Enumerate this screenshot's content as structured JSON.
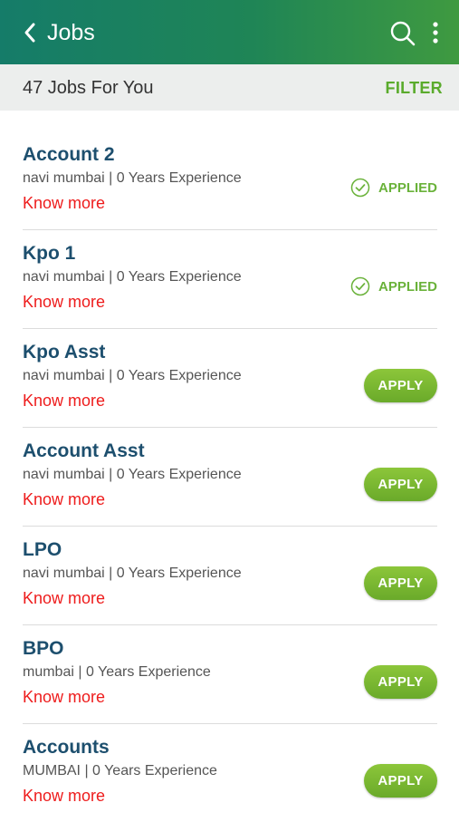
{
  "header": {
    "title": "Jobs",
    "icons": {
      "back": "chevron-left-icon",
      "search": "search-icon",
      "more": "more-vertical-icon"
    }
  },
  "subheader": {
    "count_text": "47 Jobs For You",
    "filter_label": "FILTER"
  },
  "jobs": [
    {
      "title": "Account 2",
      "meta": "navi mumbai | 0 Years Experience",
      "link": "Know more",
      "status": "APPLIED"
    },
    {
      "title": "Kpo 1",
      "meta": "navi mumbai | 0 Years Experience",
      "link": "Know more",
      "status": "APPLIED"
    },
    {
      "title": "Kpo Asst",
      "meta": "navi mumbai | 0 Years Experience",
      "link": "Know more",
      "status": "APPLY"
    },
    {
      "title": "Account Asst",
      "meta": "navi mumbai | 0 Years Experience",
      "link": "Know more",
      "status": "APPLY"
    },
    {
      "title": "LPO",
      "meta": "navi mumbai | 0 Years Experience",
      "link": "Know more",
      "status": "APPLY"
    },
    {
      "title": "BPO",
      "meta": "mumbai | 0 Years Experience",
      "link": "Know more",
      "status": "APPLY"
    },
    {
      "title": "Accounts",
      "meta": "MUMBAI | 0 Years Experience",
      "link": "Know more",
      "status": "APPLY"
    }
  ],
  "colors": {
    "header_start": "#157c69",
    "header_end": "#3f9a40",
    "accent_green": "#6ab23a",
    "link_red": "#ee1c1c",
    "title_blue": "#1d4f6e"
  }
}
